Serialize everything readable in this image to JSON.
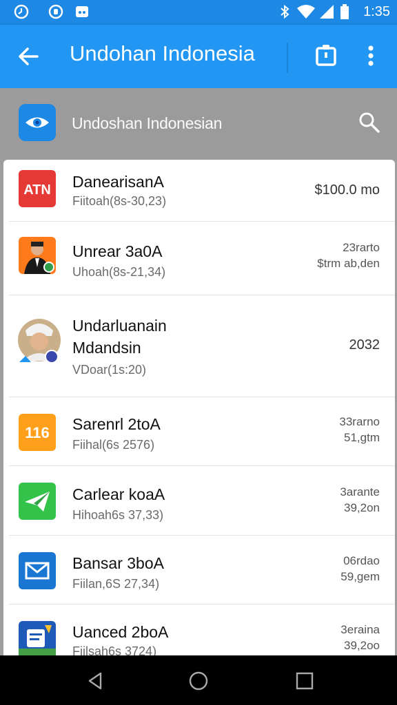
{
  "status_bar": {
    "time": "1:35"
  },
  "app_bar": {
    "title": "Undohan Indonesia"
  },
  "search_bar": {
    "title": "Undoshan Indonesian"
  },
  "items": [
    {
      "name": "DanearisanA",
      "subtitle": "Fiitoah(8s-30,23)",
      "amount": "$100.0 mo",
      "icon": "atn-logo-icon",
      "color": "#e53935",
      "icon_text": "ATN"
    },
    {
      "name": "Unrear 3a0A",
      "subtitle": "Uhoah(8s-21,34)",
      "amount_line1": "23rarto",
      "amount_line2": "$trm ab,den",
      "icon": "person-avatar-icon",
      "color": "#ff7a1a"
    },
    {
      "name": "Undarluanain",
      "name_line2": "Mdandsin",
      "subtitle": "VDoar(1s:20)",
      "amount": "2032",
      "icon": "profile-photo-icon",
      "color": "#c9b08a"
    },
    {
      "name": "Sarenrl 2toA",
      "subtitle": "Fiihal(6s 2576)",
      "amount_line1": "33rarno",
      "amount_line2": "51,gtm",
      "icon": "number-badge-icon",
      "color": "#ff9f1a",
      "icon_text": "116"
    },
    {
      "name": "Carlear koaA",
      "subtitle": "Hihoah6s 37,33)",
      "amount_line1": "3arante",
      "amount_line2": "39,2on",
      "icon": "paper-plane-icon",
      "color": "#34c34a"
    },
    {
      "name": "Bansar 3boA",
      "subtitle": "Fiilan,6S 27,34)",
      "amount_line1": "06rdao",
      "amount_line2": "59,gem",
      "icon": "mail-icon",
      "color": "#1976d2"
    },
    {
      "name": "Uanced 2boA",
      "subtitle": "Fiilsah6s 3724)",
      "amount_line1": "3eraina",
      "amount_line2": "39,2oo",
      "icon": "notes-app-icon",
      "color": "#1e5bb8"
    }
  ]
}
